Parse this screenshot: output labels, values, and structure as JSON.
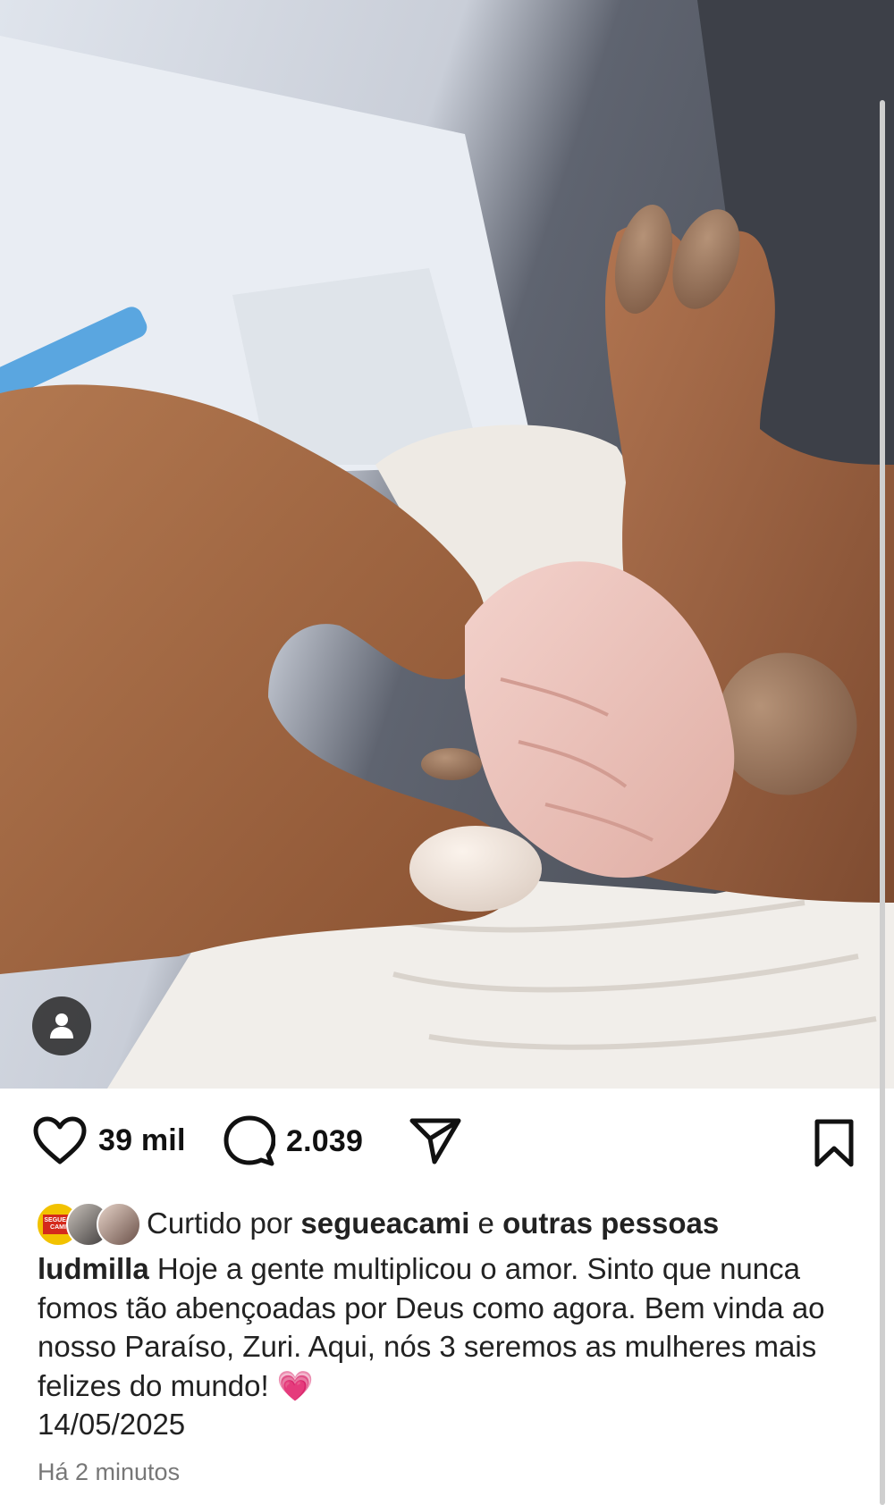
{
  "post": {
    "image_alt": "Foto de mãos segurando a mão de um bebê",
    "likes": "39 mil",
    "comments": "2.039",
    "liked_by_prefix": "Curtido por",
    "liked_by_user": "segueacami",
    "liked_by_connector": "e",
    "liked_by_others": "outras pessoas",
    "avatar1_text": "SEGUE A CAMI",
    "author": "ludmilla",
    "caption_text": " Hoje a gente multiplicou o amor. Sinto que nunca fomos tão abençoadas por Deus como agora. Bem vinda ao nosso Paraíso, Zuri. Aqui, nós 3 seremos as mulheres mais felizes do mundo! 💗",
    "caption_date": "14/05/2025",
    "time_ago": "Há 2 minutos"
  },
  "icons": {
    "like": "heart-icon",
    "comment": "comment-bubble-icon",
    "share": "paper-plane-icon",
    "save": "bookmark-icon",
    "user_tag": "user-icon"
  },
  "colors": {
    "text": "#111111",
    "muted": "#777777",
    "tag_bg": "#2a2a2a"
  }
}
